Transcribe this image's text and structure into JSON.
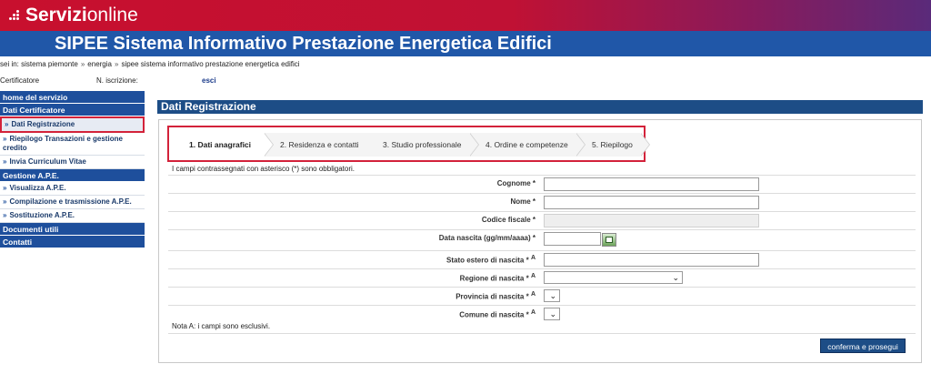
{
  "brand": {
    "name_strong": "Servizi",
    "name_light": "online"
  },
  "header": {
    "title": "SIPEE Sistema Informativo Prestazione Energetica Edifici"
  },
  "breadcrumb": {
    "prefix": "sei in:",
    "items": [
      "sistema piemonte",
      "energia",
      "sipee sistema informativo prestazione energetica edifici"
    ],
    "separator": "»"
  },
  "user": {
    "role": "Certificatore",
    "registration_label": "N. iscrizione:",
    "logout": "esci"
  },
  "sidebar": {
    "sections": [
      {
        "head": "home del servizio"
      },
      {
        "head": "Dati Certificatore",
        "items": [
          "Dati Registrazione",
          "Riepilogo Transazioni e gestione credito",
          "Invia Curriculum Vitae"
        ]
      },
      {
        "head": "Gestione A.P.E.",
        "items": [
          "Visualizza A.P.E.",
          "Compilazione e trasmissione A.P.E.",
          "Sostituzione A.P.E."
        ]
      },
      {
        "head": "Documenti utili"
      },
      {
        "head": "Contatti"
      }
    ]
  },
  "main": {
    "title": "Dati Registrazione",
    "steps": [
      "1. Dati anagrafici",
      "2. Residenza e contatti",
      "3. Studio professionale",
      "4. Ordine e competenze",
      "5. Riepilogo"
    ],
    "required_note": "I campi contrassegnati con asterisco (*) sono obbligatori.",
    "fields": {
      "cognome": "Cognome *",
      "nome": "Nome *",
      "codice_fiscale": "Codice fiscale *",
      "data_nascita": "Data nascita (gg/mm/aaaa) *",
      "stato_estero": "Stato estero di nascita *",
      "regione": "Regione di nascita *",
      "provincia": "Provincia di nascita *",
      "comune": "Comune di nascita *"
    },
    "note_marker": "A",
    "nota_a": "Nota A: i campi sono esclusivi.",
    "submit": "conferma e prosegui"
  },
  "colors": {
    "brand_red": "#c8102e",
    "title_blue": "#2057a8",
    "nav_blue": "#1e4f9c",
    "highlight_red": "#d3223a"
  }
}
